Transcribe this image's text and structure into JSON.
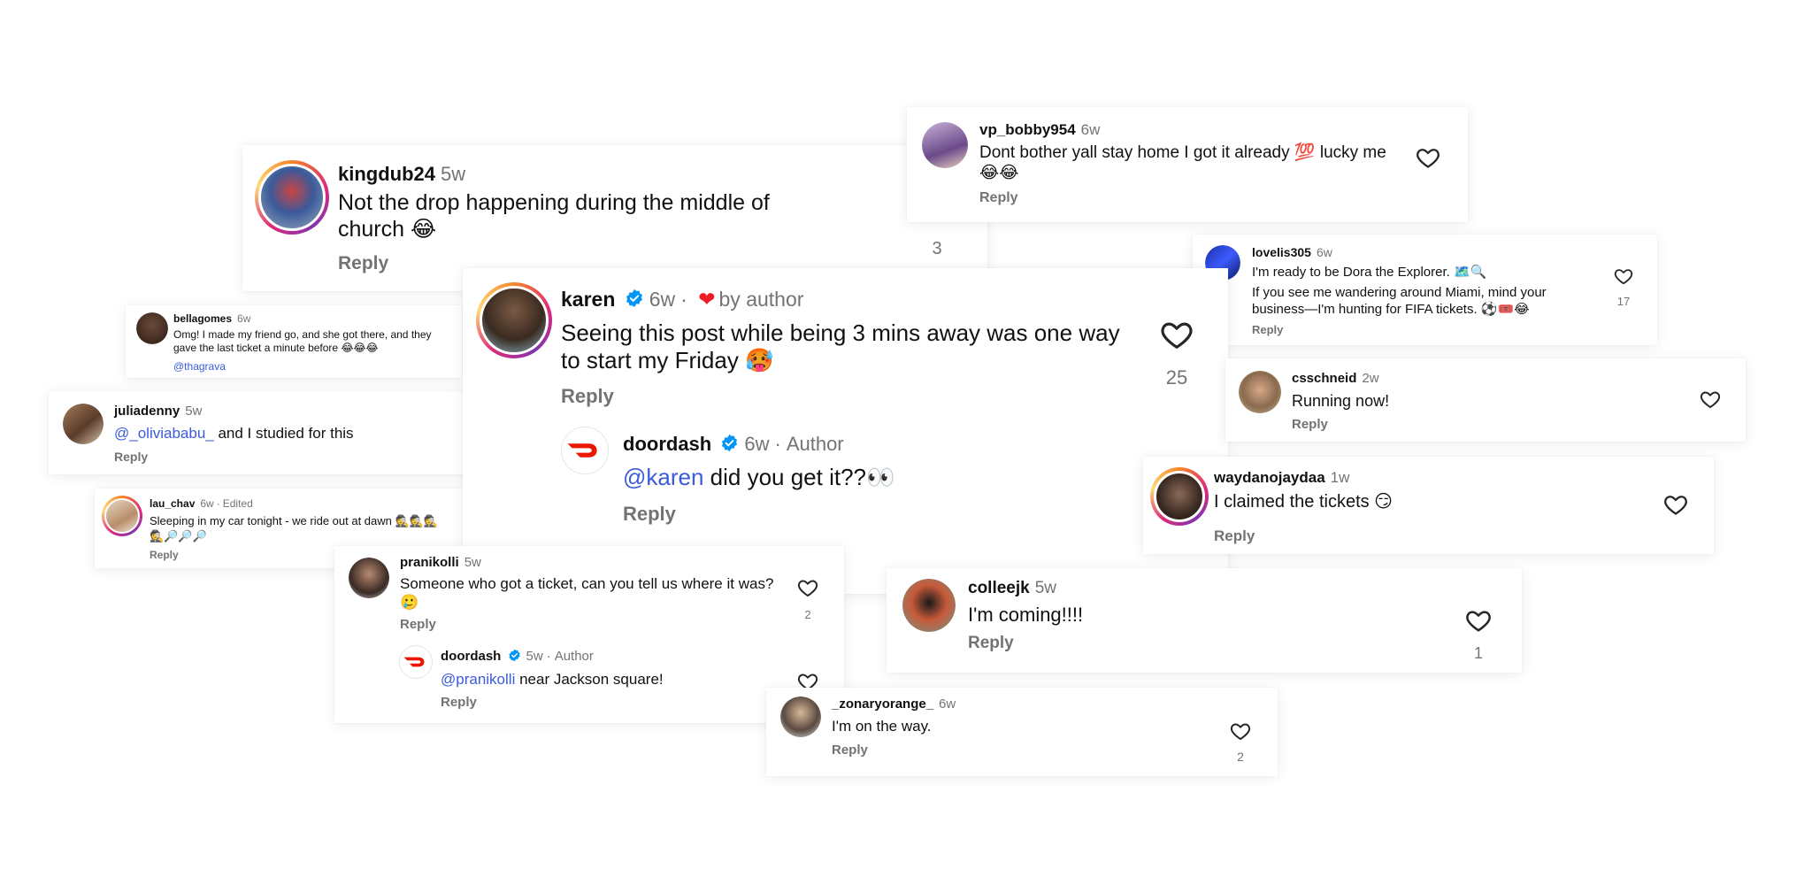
{
  "comments": {
    "kingdub": {
      "user": "kingdub24",
      "time": "5w",
      "text": "Not the drop happening during the middle of church 😂",
      "reply": "Reply",
      "count": "3"
    },
    "vp_bobby": {
      "user": "vp_bobby954",
      "time": "6w",
      "text": "Dont bother yall stay home I got it already 💯  lucky me 😂😂",
      "reply": "Reply"
    },
    "lovelis": {
      "user": "lovelis305",
      "time": "6w",
      "line1": "I'm ready to be Dora the Explorer. 🗺️🔍",
      "line2": "If you see me wandering around Miami, mind your business—I'm hunting for FIFA tickets. ⚽🎟️😂",
      "reply": "Reply",
      "count": "17"
    },
    "bellagomes": {
      "user": "bellagomes",
      "time": "6w",
      "text": "Omg! I made my friend go, and she got there, and they gave the last ticket a minute before 😂😂😂",
      "mention": "@thagrava"
    },
    "karen": {
      "user": "karen",
      "time": "6w",
      "separator": "·",
      "by_author": "by author",
      "text": "Seeing this post while being 3 mins away was one way to start my Friday 🥵",
      "reply": "Reply",
      "count": "25"
    },
    "doordash_reply_1": {
      "user": "doordash",
      "time": "6w",
      "separator": "·",
      "author": "Author",
      "mention": "@karen",
      "text": " did you get it??👀",
      "reply": "Reply"
    },
    "csschneid": {
      "user": "csschneid",
      "time": "2w",
      "text": "Running now!",
      "reply": "Reply"
    },
    "juliadenny": {
      "user": "juliadenny",
      "time": "5w",
      "mention": "@_oliviababu_",
      "text": " and I studied for this",
      "reply": "Reply"
    },
    "waydanojaydaa": {
      "user": "waydanojaydaa",
      "time": "1w",
      "text": "I claimed the tickets 😏",
      "reply": "Reply"
    },
    "lau_chav": {
      "user": "lau_chav",
      "time": "6w",
      "separator": "·",
      "edited": "Edited",
      "text": "Sleeping in my car tonight - we ride out at dawn 🕵️🕵️🕵️🕵️🔎🔎🔎",
      "reply": "Reply"
    },
    "pranikolli": {
      "user": "pranikolli",
      "time": "5w",
      "text": "Someone who got a ticket, can you tell us where it was? 🥲",
      "reply": "Reply",
      "count": "2"
    },
    "doordash_reply_2": {
      "user": "doordash",
      "time": "5w",
      "separator": "·",
      "author": "Author",
      "mention": "@pranikolli",
      "text": " near Jackson square!",
      "reply": "Reply"
    },
    "colleejk": {
      "user": "colleejk",
      "time": "5w",
      "text": "I'm coming!!!!",
      "reply": "Reply",
      "count": "1"
    },
    "zonaryorange": {
      "user": "_zonaryorange_",
      "time": "6w",
      "text": "I'm on the way.",
      "reply": "Reply",
      "count": "2"
    }
  },
  "icons": {
    "heart": "heart-outline-icon",
    "verified": "verified-badge-icon",
    "doordash_logo": "doordash-logo"
  },
  "colors": {
    "mention": "#3b5bdb",
    "verified": "#0095f6",
    "doordash_red": "#eb1700",
    "muted": "#737373"
  }
}
